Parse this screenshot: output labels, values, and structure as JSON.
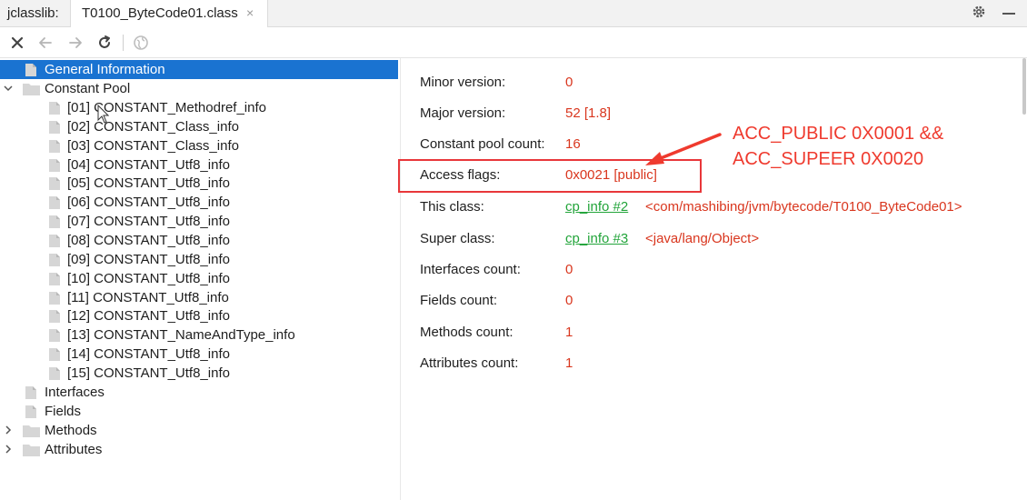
{
  "app": {
    "name": "jclasslib:"
  },
  "tab": {
    "title": "T0100_ByteCode01.class",
    "close_glyph": "×"
  },
  "toolbar": {
    "buttons": [
      {
        "name": "close-button",
        "icon": "x-icon"
      },
      {
        "name": "back-button",
        "icon": "arrow-left-icon"
      },
      {
        "name": "forward-button",
        "icon": "arrow-right-icon"
      },
      {
        "name": "refresh-button",
        "icon": "refresh-icon"
      },
      {
        "name": "browser-button",
        "icon": "globe-icon"
      }
    ]
  },
  "tree": {
    "general": "General Information",
    "constant_pool": "Constant Pool",
    "constants": [
      "[01] CONSTANT_Methodref_info",
      "[02] CONSTANT_Class_info",
      "[03] CONSTANT_Class_info",
      "[04] CONSTANT_Utf8_info",
      "[05] CONSTANT_Utf8_info",
      "[06] CONSTANT_Utf8_info",
      "[07] CONSTANT_Utf8_info",
      "[08] CONSTANT_Utf8_info",
      "[09] CONSTANT_Utf8_info",
      "[10] CONSTANT_Utf8_info",
      "[11] CONSTANT_Utf8_info",
      "[12] CONSTANT_Utf8_info",
      "[13] CONSTANT_NameAndType_info",
      "[14] CONSTANT_Utf8_info",
      "[15] CONSTANT_Utf8_info"
    ],
    "interfaces": "Interfaces",
    "fields": "Fields",
    "methods": "Methods",
    "attributes": "Attributes"
  },
  "details": {
    "minor_version": {
      "label": "Minor version:",
      "value": "0"
    },
    "major_version": {
      "label": "Major version:",
      "value": "52 [1.8]"
    },
    "constant_pool_count": {
      "label": "Constant pool count:",
      "value": "16"
    },
    "access_flags": {
      "label": "Access flags:",
      "value": "0x0021 [public]"
    },
    "this_class": {
      "label": "This class:",
      "link": "cp_info #2",
      "ref": "<com/mashibing/jvm/bytecode/T0100_ByteCode01>"
    },
    "super_class": {
      "label": "Super class:",
      "link": "cp_info #3",
      "ref": "<java/lang/Object>"
    },
    "interfaces_count": {
      "label": "Interfaces count:",
      "value": "0"
    },
    "fields_count": {
      "label": "Fields count:",
      "value": "0"
    },
    "methods_count": {
      "label": "Methods count:",
      "value": "1"
    },
    "attributes_count": {
      "label": "Attributes count:",
      "value": "1"
    }
  },
  "annotation": {
    "line1": "ACC_PUBLIC 0X0001  &&",
    "line2": "ACC_SUPEER 0X0020"
  },
  "colors": {
    "selection": "#1a73d1",
    "value_red": "#d9361e",
    "link_green": "#22a43a",
    "annotation_red": "#ef3a2e"
  }
}
